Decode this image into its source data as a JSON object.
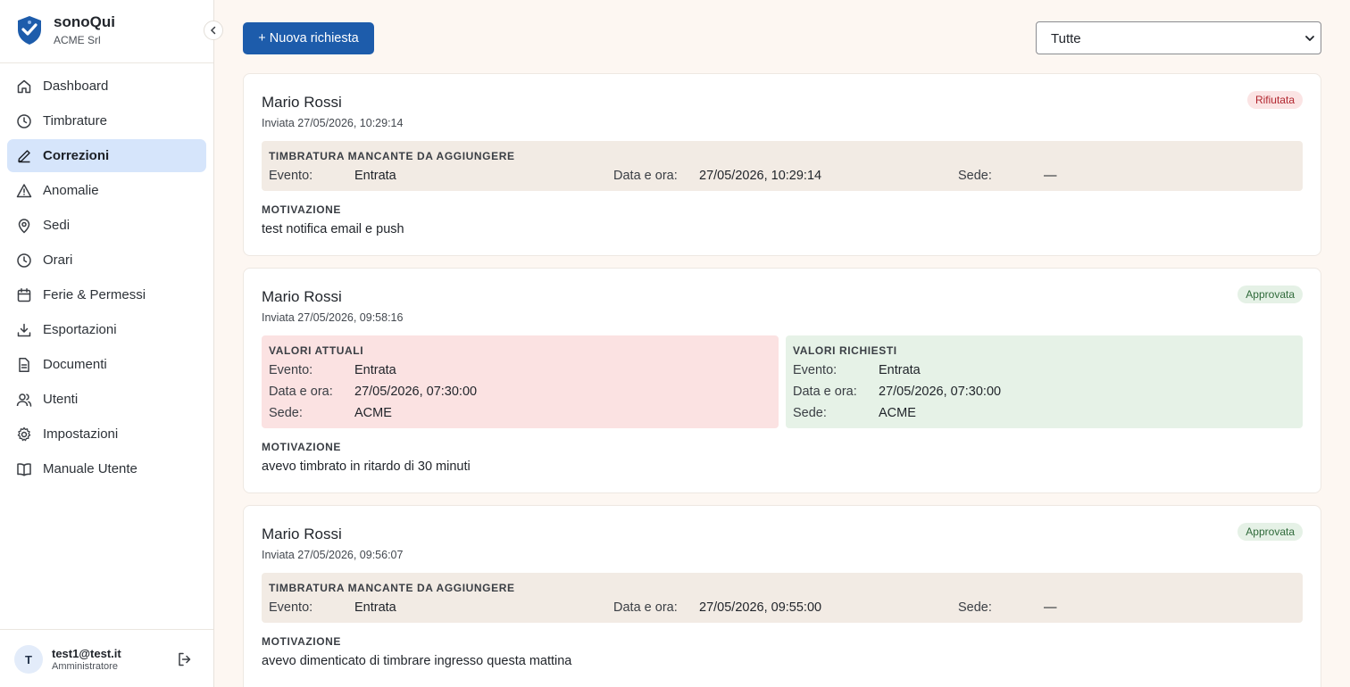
{
  "brand": {
    "name": "sonoQui",
    "company": "ACME Srl",
    "color": "#1d5cab"
  },
  "nav": [
    {
      "label": "Dashboard",
      "icon": "home-icon",
      "active": false
    },
    {
      "label": "Timbrature",
      "icon": "clock-icon",
      "active": false
    },
    {
      "label": "Correzioni",
      "icon": "pencil-icon",
      "active": true
    },
    {
      "label": "Anomalie",
      "icon": "warning-icon",
      "active": false
    },
    {
      "label": "Sedi",
      "icon": "map-pin-icon",
      "active": false
    },
    {
      "label": "Orari",
      "icon": "clock-icon",
      "active": false
    },
    {
      "label": "Ferie & Permessi",
      "icon": "calendar-icon",
      "active": false
    },
    {
      "label": "Esportazioni",
      "icon": "download-icon",
      "active": false
    },
    {
      "label": "Documenti",
      "icon": "document-icon",
      "active": false
    },
    {
      "label": "Utenti",
      "icon": "users-icon",
      "active": false
    },
    {
      "label": "Impostazioni",
      "icon": "gear-icon",
      "active": false
    },
    {
      "label": "Manuale Utente",
      "icon": "book-icon",
      "active": false
    }
  ],
  "user": {
    "initial": "T",
    "email": "test1@test.it",
    "role": "Amministratore"
  },
  "toolbar": {
    "new_label": "+ Nuova richiesta",
    "filter_value": "Tutte"
  },
  "cards": [
    {
      "name": "Mario Rossi",
      "sent": "Inviata 27/05/2026, 10:29:14",
      "status": "Rifiutata",
      "panel": {
        "title": "TIMBRATURA MANCANTE DA AGGIUNGERE",
        "evento_label": "Evento:",
        "evento": "Entrata",
        "data_label": "Data e ora:",
        "data": "27/05/2026, 10:29:14",
        "sede_label": "Sede:",
        "sede": "—"
      },
      "reason_title": "MOTIVAZIONE",
      "reason": "test notifica email e push"
    },
    {
      "name": "Mario Rossi",
      "sent": "Inviata 27/05/2026, 09:58:16",
      "status": "Approvata",
      "current": {
        "title": "VALORI ATTUALI",
        "evento_label": "Evento:",
        "evento": "Entrata",
        "data_label": "Data e ora:",
        "data": "27/05/2026, 07:30:00",
        "sede_label": "Sede:",
        "sede": "ACME"
      },
      "requested": {
        "title": "VALORI RICHIESTI",
        "evento_label": "Evento:",
        "evento": "Entrata",
        "data_label": "Data e ora:",
        "data": "27/05/2026, 07:30:00",
        "sede_label": "Sede:",
        "sede": "ACME"
      },
      "reason_title": "MOTIVAZIONE",
      "reason": "avevo timbrato in ritardo di 30 minuti"
    },
    {
      "name": "Mario Rossi",
      "sent": "Inviata 27/05/2026, 09:56:07",
      "status": "Approvata",
      "panel": {
        "title": "TIMBRATURA MANCANTE DA AGGIUNGERE",
        "evento_label": "Evento:",
        "evento": "Entrata",
        "data_label": "Data e ora:",
        "data": "27/05/2026, 09:55:00",
        "sede_label": "Sede:",
        "sede": "—"
      },
      "reason_title": "MOTIVAZIONE",
      "reason": "avevo dimenticato di timbrare ingresso questa mattina"
    }
  ]
}
